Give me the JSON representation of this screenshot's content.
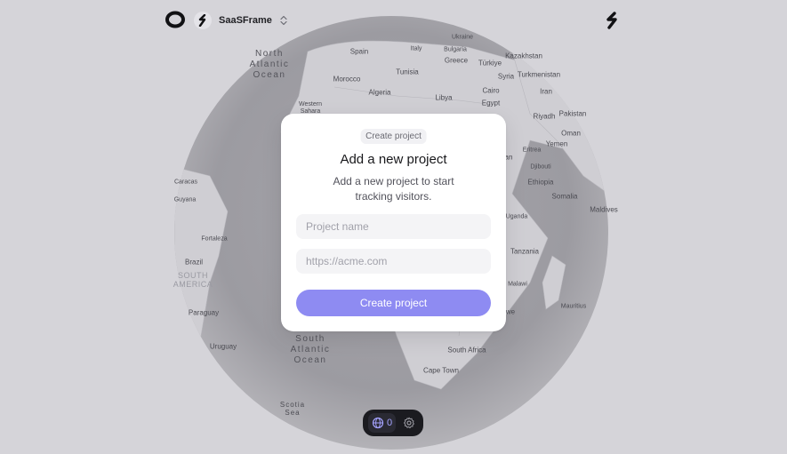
{
  "topbar": {
    "workspace_name": "SaaSFrame"
  },
  "map": {
    "labels": {
      "north_atlantic": "North\nAtlantic\nOcean",
      "south_atlantic": "South\nAtlantic\nOcean",
      "scotia": "Scotia\nSea",
      "south_america": "SOUTH\nAMERICA",
      "ukraine": "Ukraine",
      "italy": "Italy",
      "bulgaria": "Bulgaria",
      "greece": "Greece",
      "turkiye": "Türkiye",
      "kazakhstan": "Kazakhstan",
      "turkmenistan": "Turkmenistan",
      "spain": "Spain",
      "tunisia": "Tunisia",
      "morocco": "Morocco",
      "algeria": "Algeria",
      "libya": "Libya",
      "syria": "Syria",
      "cairo": "Cairo",
      "egypt": "Egypt",
      "iran": "Iran",
      "western_sahara": "Western\nSahara",
      "riyadh": "Riyadh",
      "pakistan": "Pakistan",
      "oman": "Oman",
      "yemen": "Yemen",
      "eritrea": "Eritrea",
      "djibouti": "Djibouti",
      "sudan_fragment": "an",
      "ethiopia": "Ethiopia",
      "somalia": "Somalia",
      "maldives": "Maldives",
      "uganda": "Uganda",
      "tanzania": "Tanzania",
      "malawi": "Malawi",
      "zimbabwe_fragment": "we",
      "mauritius": "Mauritius",
      "south_africa": "South Africa",
      "cape_town": "Cape Town",
      "caracas": "Caracas",
      "guyana": "Guyana",
      "fortaleza": "Fortaleza",
      "brazil": "Brazil",
      "paraguay": "Paraguay",
      "uruguay": "Uruguay"
    }
  },
  "modal": {
    "badge": "Create project",
    "title": "Add a new project",
    "description": "Add a new project to start tracking visitors.",
    "name_field": {
      "value": "",
      "placeholder": "Project name"
    },
    "url_field": {
      "value": "",
      "placeholder": "https://acme.com"
    },
    "submit_label": "Create project"
  },
  "dock": {
    "visitor_count": "0"
  },
  "colors": {
    "background": "#d5d4d9",
    "accent": "#8e8bf2",
    "dock": "#1b1b20"
  },
  "icons": {
    "logo": "ring-logo-icon",
    "workspace": "saasframe-logo-icon",
    "switcher": "chevron-up-down-icon",
    "brand": "saasframe-logo-icon",
    "globe": "globe-icon",
    "settings": "gear-icon"
  }
}
